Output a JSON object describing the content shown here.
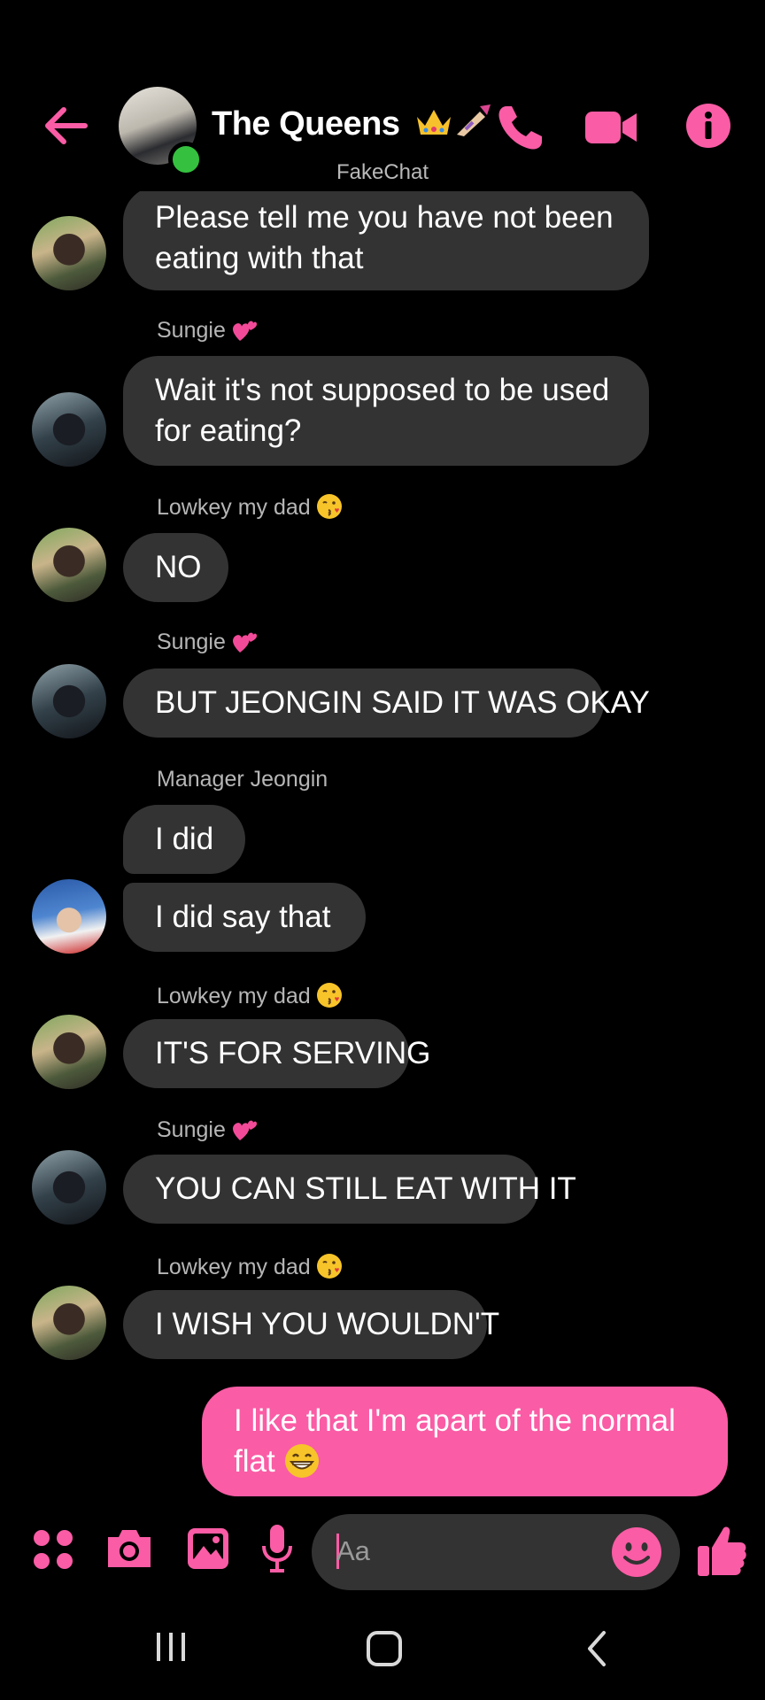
{
  "header": {
    "title": "The Queens",
    "subtitle": "FakeChat"
  },
  "senders": {
    "lowkey": "Lowkey my dad",
    "sungie": "Sungie",
    "jeongin": "Manager Jeongin"
  },
  "messages": [
    {
      "text_1": "Please tell me you have not been",
      "text_2": "eating with that"
    },
    {
      "text_1": "Wait it's not supposed to be used",
      "text_2": "for eating?"
    },
    {
      "text": "NO"
    },
    {
      "text": "BUT JEONGIN SAID IT WAS OKAY"
    },
    {
      "text": "I did"
    },
    {
      "text": "I did say that"
    },
    {
      "text": "IT'S FOR SERVING"
    },
    {
      "text": "YOU CAN STILL EAT WITH IT"
    },
    {
      "text": "I WISH YOU WOULDN'T"
    },
    {
      "text_1": "I like that I'm apart of the normal",
      "text_2": "flat"
    }
  ],
  "composer": {
    "placeholder": "Aa"
  },
  "colors": {
    "accent": "#fa5ca5",
    "bubble": "#333333",
    "online": "#35c13f",
    "background": "#000000"
  },
  "icons": [
    "back-arrow-icon",
    "phone-icon",
    "video-camera-icon",
    "info-icon",
    "apps-grid-icon",
    "camera-icon",
    "image-icon",
    "microphone-icon",
    "smiley-icon",
    "thumbs-up-icon",
    "recent-apps-icon",
    "home-icon",
    "nav-back-icon",
    "crown-emoji",
    "nail-polish-emoji",
    "two-hearts-emoji",
    "kissing-face-emoji",
    "grinning-face-emoji"
  ]
}
